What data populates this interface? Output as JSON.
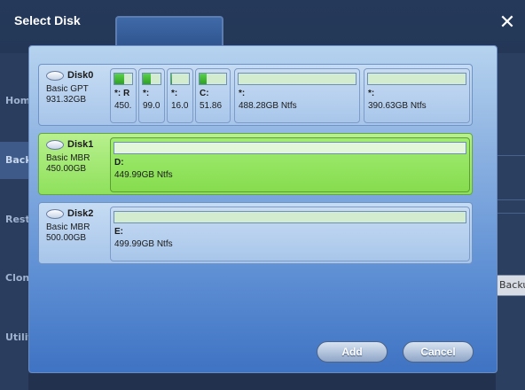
{
  "dialog": {
    "title": "Select Disk",
    "close_glyph": "✕",
    "add_label": "Add",
    "cancel_label": "Cancel"
  },
  "background": {
    "nav_items": [
      "Home",
      "Backup",
      "Restore",
      "Clone",
      "Utilities"
    ],
    "active_nav_index": 1,
    "backup_button_label": "Backup"
  },
  "disks": [
    {
      "name": "Disk0",
      "type": "Basic GPT",
      "size": "931.32GB",
      "selected": false,
      "partitions": [
        {
          "label": "*: R",
          "size": "450.",
          "fill": 0.55
        },
        {
          "label": "*:",
          "size": "99.0",
          "fill": 0.45
        },
        {
          "label": "*:",
          "size": "16.0",
          "fill": 0.05
        },
        {
          "label": "C:",
          "size": "51.86",
          "fill": 0.25
        },
        {
          "label": "*:",
          "size": "488.28GB Ntfs",
          "fill": 0.0
        },
        {
          "label": "*:",
          "size": "390.63GB Ntfs",
          "fill": 0.0
        }
      ]
    },
    {
      "name": "Disk1",
      "type": "Basic MBR",
      "size": "450.00GB",
      "selected": true,
      "partitions": [
        {
          "label": "D:",
          "size": "449.99GB Ntfs",
          "fill": 0.0
        }
      ]
    },
    {
      "name": "Disk2",
      "type": "Basic MBR",
      "size": "500.00GB",
      "selected": false,
      "partitions": [
        {
          "label": "E:",
          "size": "499.99GB Ntfs",
          "fill": 0.0
        }
      ]
    }
  ],
  "colors": {
    "selected_row": "#8fe15c",
    "normal_row": "#a7c5ea",
    "used_fill": "#2ea024"
  }
}
